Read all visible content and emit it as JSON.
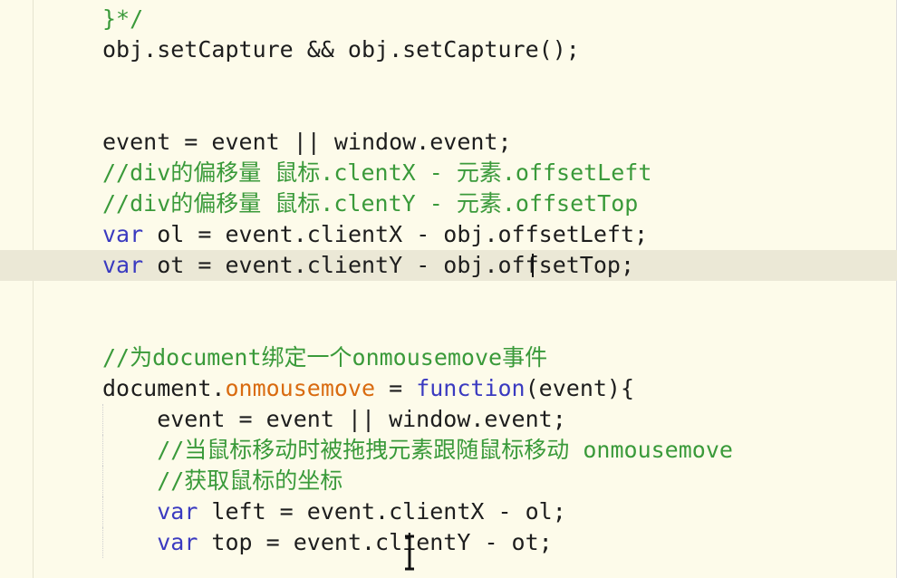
{
  "editor": {
    "lines": [
      [
        {
          "t": "}*/",
          "c": "comment"
        }
      ],
      [
        {
          "t": "obj.setCapture && obj.setCapture();",
          "c": "plain"
        }
      ],
      [],
      [],
      [
        {
          "t": "event = event || window.event;",
          "c": "plain"
        }
      ],
      [
        {
          "t": "//div的偏移量 鼠标.clentX - 元素.offsetLeft",
          "c": "comment"
        }
      ],
      [
        {
          "t": "//div的偏移量 鼠标.clentY - 元素.offsetTop",
          "c": "comment"
        }
      ],
      [
        {
          "t": "var",
          "c": "kw"
        },
        {
          "t": " ol = ",
          "c": "plain"
        },
        {
          "t": "event",
          "c": "plain"
        },
        {
          "t": ".clientX - obj.offsetLeft;",
          "c": "plain"
        }
      ],
      [
        {
          "t": "var",
          "c": "kw"
        },
        {
          "t": " ot = ",
          "c": "plain"
        },
        {
          "t": "event",
          "c": "plain"
        },
        {
          "t": ".clientY - obj.offsetTop;",
          "c": "plain"
        }
      ],
      [],
      [],
      [
        {
          "t": "//为document绑定一个onmousemove事件",
          "c": "comment"
        }
      ],
      [
        {
          "t": "document.",
          "c": "plain"
        },
        {
          "t": "onmousemove",
          "c": "prop"
        },
        {
          "t": " = ",
          "c": "plain"
        },
        {
          "t": "function",
          "c": "fn"
        },
        {
          "t": "(event){",
          "c": "plain"
        }
      ],
      [
        {
          "t": "    event = event || window.event;",
          "c": "plain"
        }
      ],
      [
        {
          "t": "    //当鼠标移动时被拖拽元素跟随鼠标移动 onmousemove",
          "c": "comment"
        }
      ],
      [
        {
          "t": "    //获取鼠标的坐标",
          "c": "comment"
        }
      ],
      [
        {
          "t": "    ",
          "c": "plain"
        },
        {
          "t": "var",
          "c": "kw"
        },
        {
          "t": " left = event.clientX - ol;",
          "c": "plain"
        }
      ],
      [
        {
          "t": "    ",
          "c": "plain"
        },
        {
          "t": "var",
          "c": "kw"
        },
        {
          "t": " top = event.clientY - ot;",
          "c": "plain"
        }
      ]
    ],
    "current_line": 8
  },
  "colors": {
    "background": "#fdfbea",
    "current_line": "#ebe8d6",
    "comment": "#3a9a3a",
    "keyword": "#3a3ac0",
    "property": "#d96b10",
    "plain": "#1d1d1d"
  }
}
